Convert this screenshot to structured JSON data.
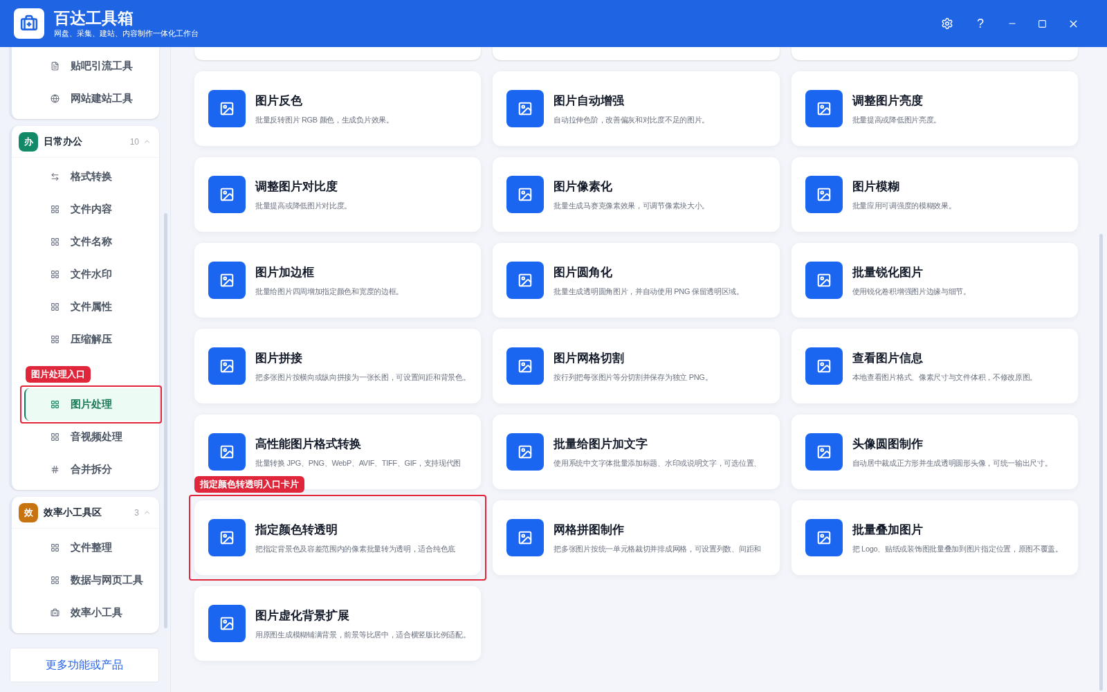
{
  "header": {
    "title": "百达工具箱",
    "subtitle": "网盘、采集、建站、内容制作一体化工作台",
    "help": "?"
  },
  "sidebar": {
    "groups": [
      {
        "items": [
          {
            "label": "贴吧引流工具",
            "kind": "doc",
            "selected": false
          },
          {
            "label": "网站建站工具",
            "kind": "globe",
            "selected": false
          }
        ]
      },
      {
        "badge": "办",
        "color": "#128a6a",
        "title": "日常办公",
        "count": "10",
        "expanded": true,
        "items": [
          {
            "label": "格式转换",
            "kind": "swap",
            "selected": false
          },
          {
            "label": "文件内容",
            "kind": "grid",
            "selected": false
          },
          {
            "label": "文件名称",
            "kind": "grid",
            "selected": false
          },
          {
            "label": "文件水印",
            "kind": "grid",
            "selected": false
          },
          {
            "label": "文件属性",
            "kind": "grid",
            "selected": false
          },
          {
            "label": "压缩解压",
            "kind": "grid",
            "selected": false
          },
          {
            "label": "图片处理",
            "kind": "grid",
            "selected": true,
            "annotation": "图片处理入口"
          },
          {
            "label": "音视频处理",
            "kind": "grid",
            "selected": false
          },
          {
            "label": "合并拆分",
            "kind": "hash",
            "selected": false
          }
        ]
      },
      {
        "badge": "效",
        "color": "#c7730f",
        "title": "效率小工具区",
        "count": "3",
        "expanded": true,
        "items": [
          {
            "label": "文件整理",
            "kind": "grid",
            "selected": false
          },
          {
            "label": "数据与网页工具",
            "kind": "grid",
            "selected": false
          },
          {
            "label": "效率小工具",
            "kind": "kit",
            "selected": false
          }
        ]
      }
    ],
    "more_button": "更多功能或产品"
  },
  "cards": [
    {
      "title": "图片反色",
      "desc": "批量反转图片 RGB 颜色，生成负片效果。"
    },
    {
      "title": "图片自动增强",
      "desc": "自动拉伸色阶，改善偏灰和对比度不足的图片。"
    },
    {
      "title": "调整图片亮度",
      "desc": "批量提高或降低图片亮度。"
    },
    {
      "title": "调整图片对比度",
      "desc": "批量提高或降低图片对比度。"
    },
    {
      "title": "图片像素化",
      "desc": "批量生成马赛克像素效果，可调节像素块大小。"
    },
    {
      "title": "图片模糊",
      "desc": "批量应用可调强度的模糊效果。"
    },
    {
      "title": "图片加边框",
      "desc": "批量给图片四周增加指定颜色和宽度的边框。"
    },
    {
      "title": "图片圆角化",
      "desc": "批量生成透明圆角图片，并自动使用 PNG 保留透明区域。"
    },
    {
      "title": "批量锐化图片",
      "desc": "使用锐化卷积增强图片边缘与细节。"
    },
    {
      "title": "图片拼接",
      "desc": "把多张图片按横向或纵向拼接为一张长图，可设置间距和背景色。"
    },
    {
      "title": "图片网格切割",
      "desc": "按行列把每张图片等分切割并保存为独立 PNG。"
    },
    {
      "title": "查看图片信息",
      "desc": "本地查看图片格式、像素尺寸与文件体积，不修改原图。"
    },
    {
      "title": "高性能图片格式转换",
      "desc": "批量转换 JPG、PNG、WebP、AVIF、TIFF、GIF，支持现代图"
    },
    {
      "title": "批量给图片加文字",
      "desc": "使用系统中文字体批量添加标题、水印或说明文字，可选位置、"
    },
    {
      "title": "头像圆图制作",
      "desc": "自动居中裁成正方形并生成透明圆形头像，可统一输出尺寸。"
    },
    {
      "title": "指定颜色转透明",
      "desc": "把指定背景色及容差范围内的像素批量转为透明，适合纯色底",
      "annotation": "指定颜色转透明入口卡片"
    },
    {
      "title": "网格拼图制作",
      "desc": "把多张图片按统一单元格裁切并排成网格，可设置列数、间距和"
    },
    {
      "title": "批量叠加图片",
      "desc": "把 Logo、贴纸或装饰图批量叠加到图片指定位置，原图不覆盖。"
    },
    {
      "title": "图片虚化背景扩展",
      "desc": "用原图生成模糊铺满背景，前景等比居中，适合横竖版比例适配。"
    }
  ]
}
